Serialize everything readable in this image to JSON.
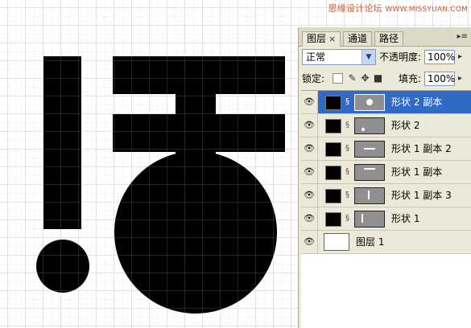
{
  "watermark": {
    "text": "思缘设计论坛",
    "url": "WWW.MISSYUAN.COM"
  },
  "colors": {
    "canvas": "#ffffff",
    "grid": "#c8c8c8",
    "shape": "#000000",
    "panel": "#ece9d8",
    "selected": "#316ac5"
  },
  "panel": {
    "tabs": [
      {
        "label": "图层",
        "close": "×"
      },
      {
        "label": "通道"
      },
      {
        "label": "路径"
      }
    ],
    "menu_icon": "panel-menu-icon",
    "blend_mode": "正常",
    "opacity_label": "不透明度:",
    "opacity_value": "100%",
    "lock_label": "锁定:",
    "fill_label": "填充:",
    "fill_value": "100%",
    "lock_icons": [
      "lock-transparent-icon",
      "lock-brush-icon",
      "lock-move-icon",
      "lock-all-icon"
    ]
  },
  "layers": [
    {
      "name": "形状 2 副本",
      "selected": true,
      "thumb": "dot"
    },
    {
      "name": "形状 2",
      "selected": false,
      "thumb": "dot-small"
    },
    {
      "name": "形状 1 副本 2",
      "selected": false,
      "thumb": "hline"
    },
    {
      "name": "形状 1 副本",
      "selected": false,
      "thumb": "hline-top"
    },
    {
      "name": "形状 1 副本 3",
      "selected": false,
      "thumb": "vline"
    },
    {
      "name": "形状 1",
      "selected": false,
      "thumb": "vline-left"
    },
    {
      "name": "图层 1",
      "selected": false,
      "thumb": "blank",
      "background": true
    }
  ]
}
